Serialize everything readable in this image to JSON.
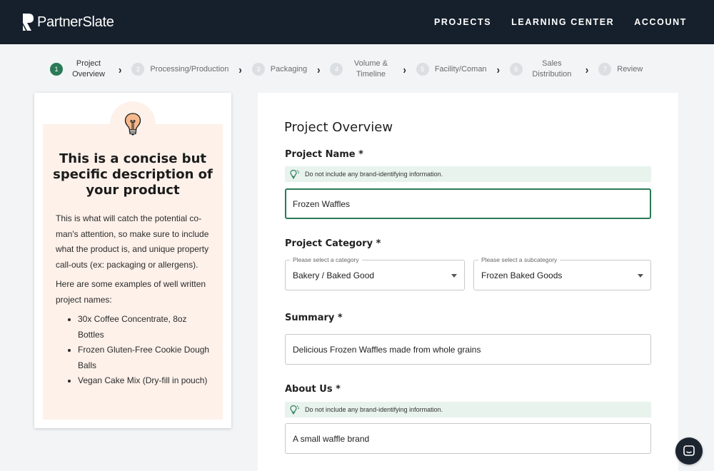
{
  "brand": {
    "name": "PartnerSlate"
  },
  "nav": {
    "items": [
      "PROJECTS",
      "LEARNING CENTER",
      "ACCOUNT"
    ]
  },
  "stepper": {
    "steps": [
      {
        "num": "1",
        "label": "Project Overview",
        "active": true
      },
      {
        "num": "2",
        "label": "Processing/Production"
      },
      {
        "num": "3",
        "label": "Packaging"
      },
      {
        "num": "4",
        "label": "Volume & Timeline"
      },
      {
        "num": "5",
        "label": "Facility/Coman"
      },
      {
        "num": "6",
        "label": "Sales Distribution"
      },
      {
        "num": "7",
        "label": "Review"
      }
    ]
  },
  "tip": {
    "title": "This is a concise but specific description of your product",
    "para1": "This is what will catch the potential co-man's attention, so make sure to include what the product is, and unique property call-outs (ex: packaging or allergens).",
    "para2": "Here are some examples of well written project names:",
    "examples": [
      "30x Coffee Concentrate, 8oz Bottles",
      "Frozen Gluten-Free Cookie Dough Balls",
      "Vegan Cake Mix (Dry-fill in pouch)"
    ]
  },
  "form": {
    "title": "Project Overview",
    "project_name": {
      "label": "Project Name *",
      "hint": "Do not include any brand-identifying information.",
      "value": "Frozen Waffles"
    },
    "category": {
      "label": "Project Category *",
      "category_legend": "Please select a category",
      "category_value": "Bakery / Baked Good",
      "subcategory_legend": "Please select a subcategory",
      "subcategory_value": "Frozen Baked Goods"
    },
    "summary": {
      "label": "Summary *",
      "value": "Delicious Frozen Waffles made from whole grains"
    },
    "about": {
      "label": "About Us *",
      "hint": "Do not include any brand-identifying information.",
      "value": "A small waffle brand"
    }
  },
  "colors": {
    "nav_bg": "#16202c",
    "accent": "#2a7a57",
    "tip_bg": "#fdf1ea",
    "hint_bg": "#e8f3ee"
  }
}
